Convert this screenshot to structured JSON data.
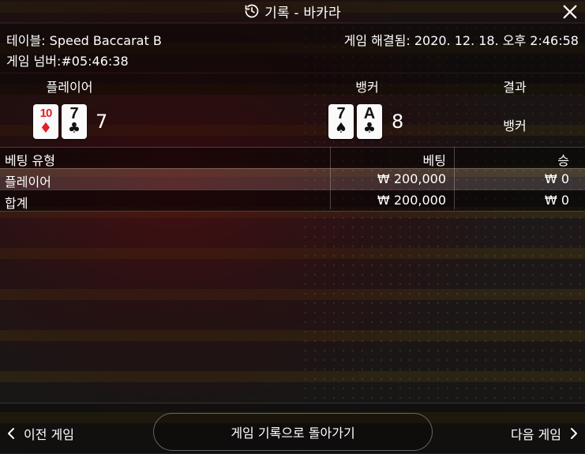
{
  "header": {
    "title": "기록 - 바카라"
  },
  "info": {
    "table_label": "테이블:",
    "table_value": "Speed Baccarat B",
    "game_number_label": "게임 넘버:",
    "game_number_value": "#05:46:38",
    "resolved_label": "게임 해결됨:",
    "resolved_value": "2020. 12. 18. 오후 2:46:58"
  },
  "result": {
    "player_header": "플레이어",
    "banker_header": "뱅커",
    "result_header": "결과",
    "player_cards": [
      {
        "rank": "10",
        "suit": "♦",
        "color": "red"
      },
      {
        "rank": "7",
        "suit": "♣",
        "color": "black"
      }
    ],
    "player_score": "7",
    "banker_cards": [
      {
        "rank": "7",
        "suit": "♠",
        "color": "black"
      },
      {
        "rank": "A",
        "suit": "♣",
        "color": "black"
      }
    ],
    "banker_score": "8",
    "outcome": "뱅커"
  },
  "bets": {
    "headers": {
      "type": "베팅 유형",
      "bet": "베팅",
      "win": "승"
    },
    "rows": [
      {
        "type": "플레이어",
        "bet": "₩ 200,000",
        "win": "₩ 0"
      }
    ],
    "total": {
      "type": "합계",
      "bet": "₩ 200,000",
      "win": "₩ 0"
    }
  },
  "footer": {
    "prev_label": "이전 게임",
    "back_label": "게임 기록으로 돌아가기",
    "next_label": "다음 게임"
  },
  "colors": {
    "red_suit": "#e0212a",
    "black_suit": "#111111"
  }
}
